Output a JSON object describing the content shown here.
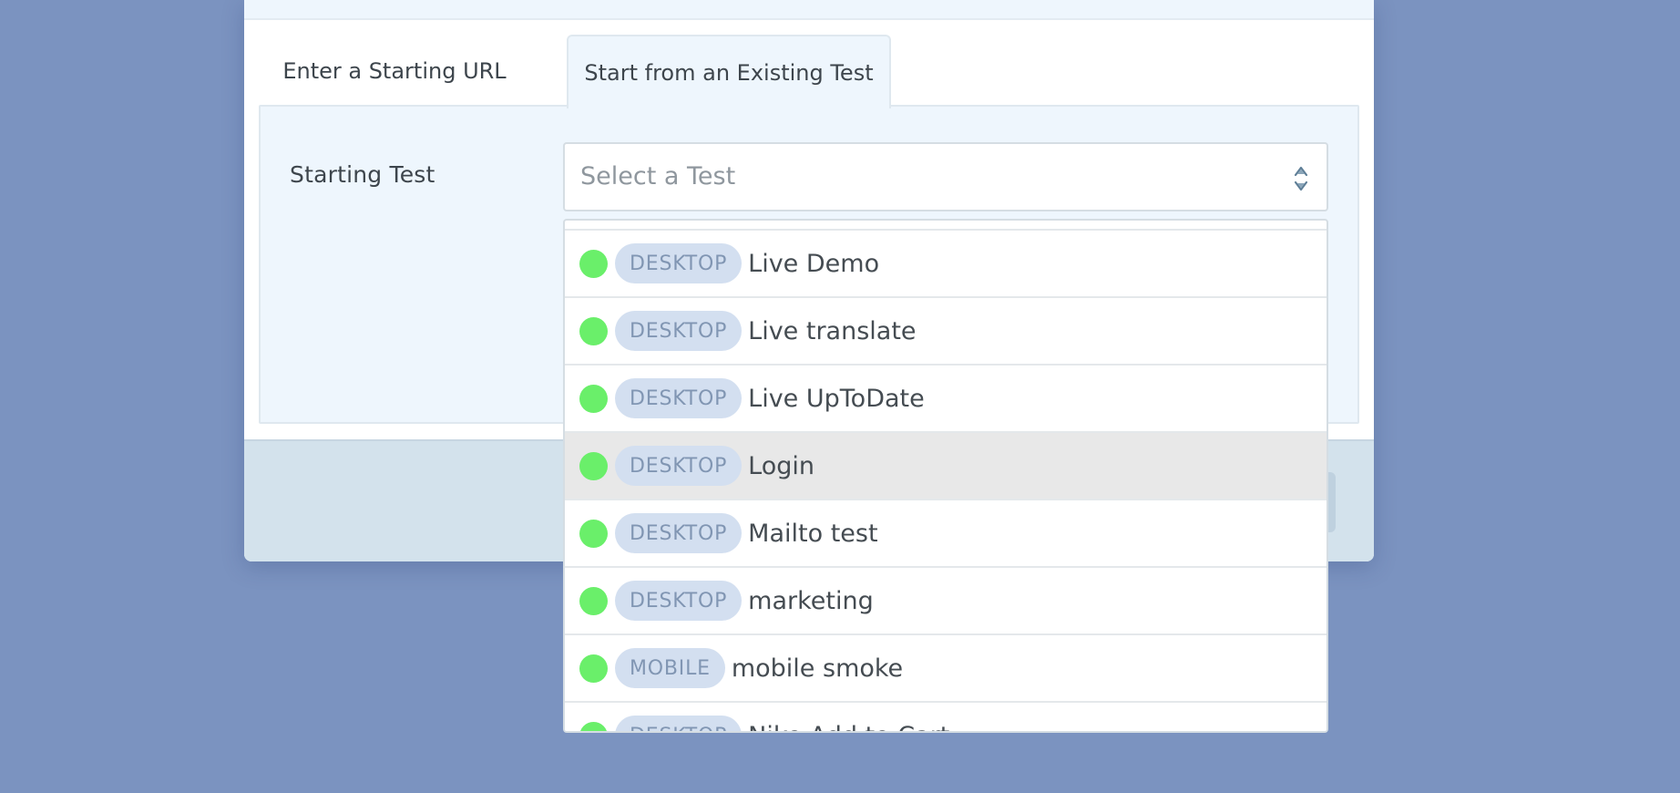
{
  "tabs": [
    {
      "label": "Enter a Starting URL",
      "active": false
    },
    {
      "label": "Start from an Existing Test",
      "active": true
    }
  ],
  "form": {
    "starting_test_label": "Starting Test",
    "select": {
      "placeholder": "Select a Test",
      "icon": "up-down-arrows-icon"
    }
  },
  "dropdown": {
    "options": [
      {
        "status": "passing",
        "platform": "DESKTOP",
        "name": "Live Demo"
      },
      {
        "status": "passing",
        "platform": "DESKTOP",
        "name": "Live translate"
      },
      {
        "status": "passing",
        "platform": "DESKTOP",
        "name": "Live UpToDate"
      },
      {
        "status": "passing",
        "platform": "DESKTOP",
        "name": "Login",
        "highlighted": true
      },
      {
        "status": "passing",
        "platform": "DESKTOP",
        "name": "Mailto test"
      },
      {
        "status": "passing",
        "platform": "DESKTOP",
        "name": "marketing"
      },
      {
        "status": "passing",
        "platform": "MOBILE",
        "name": "mobile smoke"
      },
      {
        "status": "passing",
        "platform": "DESKTOP",
        "name": "Nike Add to Cart"
      }
    ]
  },
  "colors": {
    "page_background": "#7b93c0",
    "status_passing": "#6aef6a",
    "badge_background": "#d3dff0",
    "badge_text": "#8196b3",
    "highlight_row": "#e8e8e8"
  }
}
